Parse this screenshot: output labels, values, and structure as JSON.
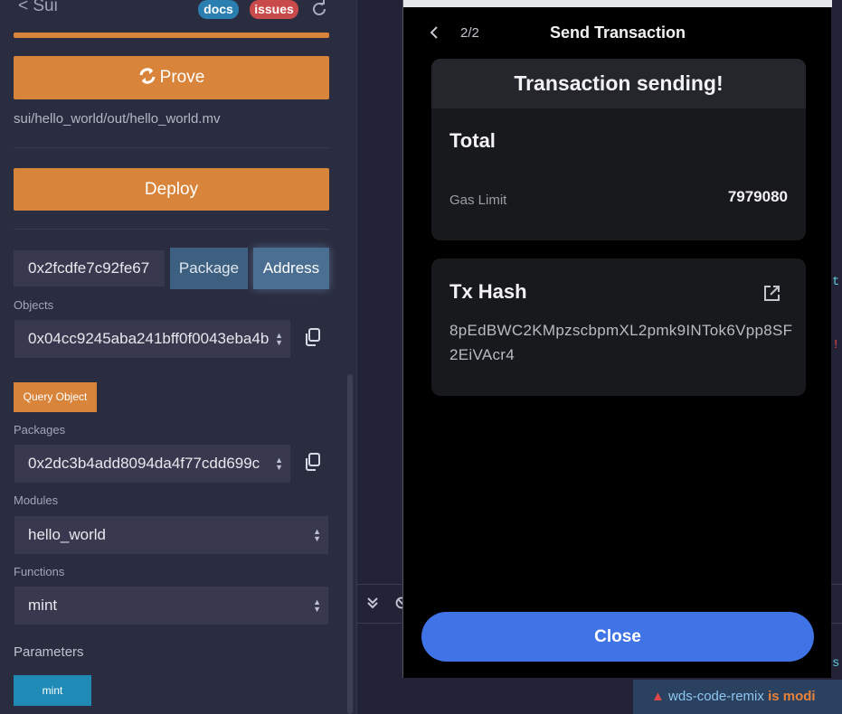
{
  "plugin": {
    "back_label": "< Sui",
    "docs_badge": "docs",
    "issues_badge": "issues",
    "prove_label": "Prove",
    "compiled_path": "sui/hello_world/out/hello_world.mv",
    "deploy_label": "Deploy",
    "address_value": "0x2fcdfe7c92fe67",
    "package_label": "Package",
    "address_label": "Address",
    "objects_label": "Objects",
    "objects_value": "0x04cc9245aba241bff0f0043eba4b",
    "query_object_label": "Query Object",
    "packages_label": "Packages",
    "packages_value": "0x2dc3b4add8094da4f77cdd699c",
    "modules_label": "Modules",
    "modules_value": "hello_world",
    "functions_label": "Functions",
    "functions_value": "mint",
    "parameters_label": "Parameters",
    "mint_label": "mint",
    "colors": {
      "accent": "#d9843b",
      "mint": "#1f8ab5",
      "panel": "#2a2c3f"
    }
  },
  "wallet": {
    "step": "2/2",
    "title": "Send Transaction",
    "status": "Transaction sending!",
    "total_label": "Total",
    "gas_limit_label": "Gas Limit",
    "gas_limit_value": "7979080",
    "tx_hash_label": "Tx Hash",
    "tx_hash_value": "8pEdBWC2KMpzscbpmXL2pmk9INTok6Vpp8SF2EiVAcr4",
    "close_label": "Close",
    "colors": {
      "primary": "#3f73e6",
      "card": "#18191d"
    }
  },
  "editor": {
    "status_warning_icon": "warning-icon",
    "status_text": "wds-code-remix",
    "status_bold": "is modi",
    "edge_chars": [
      "t",
      "!",
      "s"
    ]
  }
}
